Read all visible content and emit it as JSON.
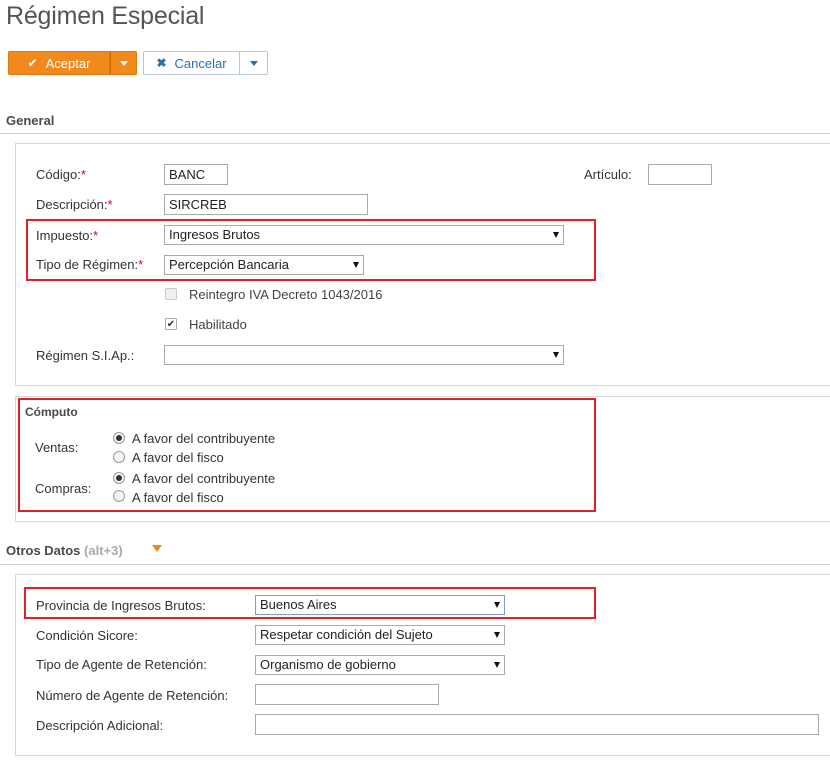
{
  "page": {
    "title": "Régimen Especial"
  },
  "toolbar": {
    "accept_label": "Aceptar",
    "cancel_label": "Cancelar"
  },
  "general": {
    "title": "General",
    "codigo": {
      "label": "Código:",
      "required": "*",
      "value": "BANC"
    },
    "articulo": {
      "label": "Artículo:",
      "value": ""
    },
    "descripcion": {
      "label": "Descripción:",
      "required": "*",
      "value": "SIRCREB"
    },
    "impuesto": {
      "label": "Impuesto:",
      "required": "*",
      "value": "Ingresos Brutos"
    },
    "tipo_regimen": {
      "label": "Tipo de Régimen:",
      "required": "*",
      "value": "Percepción Bancaria"
    },
    "reintegro": {
      "label": "Reintegro IVA Decreto 1043/2016",
      "checked": false,
      "disabled": true
    },
    "habilitado": {
      "label": "Habilitado",
      "checked": true
    },
    "regimen_siap": {
      "label": "Régimen S.I.Ap.:",
      "value": ""
    }
  },
  "computo": {
    "title": "Cómputo",
    "ventas": {
      "label": "Ventas:",
      "options": [
        "A favor del contribuyente",
        "A favor del fisco"
      ],
      "selected": 0
    },
    "compras": {
      "label": "Compras:",
      "options": [
        "A favor del contribuyente",
        "A favor del fisco"
      ],
      "selected": 0
    }
  },
  "otros": {
    "title": "Otros Datos",
    "shortcut": "(alt+3)",
    "provincia": {
      "label": "Provincia de Ingresos Brutos:",
      "value": "Buenos Aires"
    },
    "condicion": {
      "label": "Condición Sicore:",
      "value": "Respetar condición del Sujeto"
    },
    "tipo_agente": {
      "label": "Tipo de Agente de Retención:",
      "value": "Organismo de gobierno"
    },
    "numero_agente": {
      "label": "Número de Agente de Retención:",
      "value": ""
    },
    "descripcion_adicional": {
      "label": "Descripción Adicional:",
      "value": ""
    }
  },
  "colors": {
    "accent": "#f18a1c",
    "link": "#2a6fb6",
    "highlight": "#e0202a"
  }
}
